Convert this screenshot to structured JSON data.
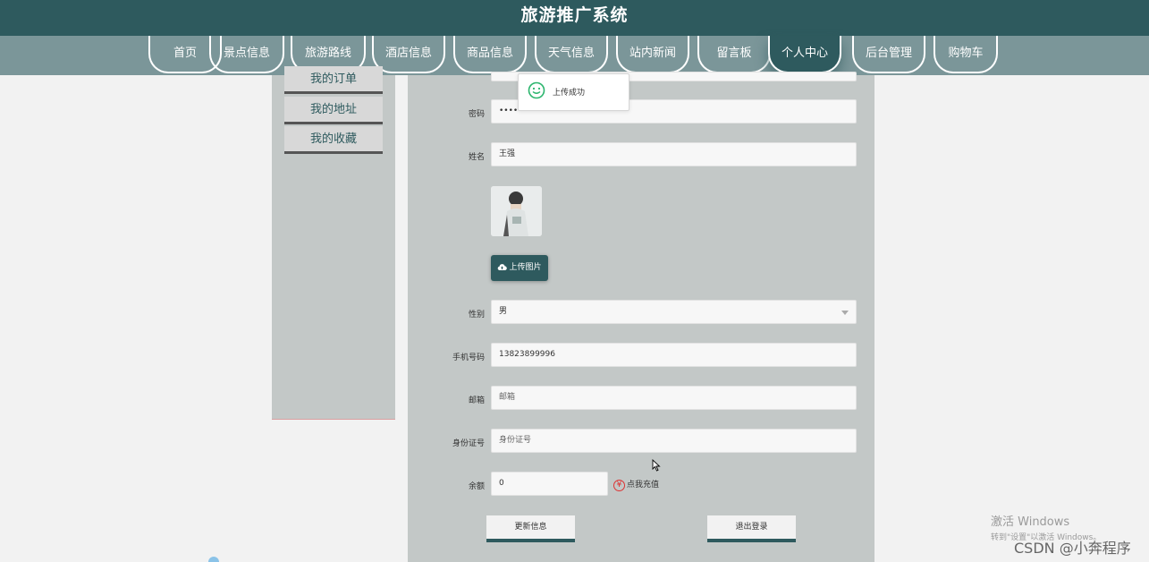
{
  "header": {
    "title": "旅游推广系统"
  },
  "nav": {
    "items": [
      {
        "label": "首页"
      },
      {
        "label": "景点信息"
      },
      {
        "label": "旅游路线"
      },
      {
        "label": "酒店信息"
      },
      {
        "label": "商品信息"
      },
      {
        "label": "天气信息"
      },
      {
        "label": "站内新闻"
      },
      {
        "label": "留言板"
      },
      {
        "label": "个人中心",
        "active": true
      },
      {
        "label": "后台管理"
      },
      {
        "label": "购物车"
      }
    ]
  },
  "sidebar": {
    "items": [
      {
        "label": "我的订单"
      },
      {
        "label": "我的地址"
      },
      {
        "label": "我的收藏"
      }
    ]
  },
  "form": {
    "password": {
      "label": "密码",
      "value": "••••••"
    },
    "name": {
      "label": "姓名",
      "value": "王强"
    },
    "upload_label": "上传图片",
    "gender": {
      "label": "性别",
      "value": "男"
    },
    "phone": {
      "label": "手机号码",
      "value": "13823899996"
    },
    "email": {
      "label": "邮箱",
      "placeholder": "邮箱"
    },
    "id_card": {
      "label": "身份证号",
      "placeholder": "身份证号"
    },
    "balance": {
      "label": "余额",
      "value": "0"
    },
    "recharge_label": "点我充值",
    "recharge_icon": "¥",
    "update_button": "更新信息",
    "logout_button": "退出登录"
  },
  "toast": {
    "message": "上传成功"
  },
  "watermark": {
    "line1": "激活 Windows",
    "line2": "转到\"设置\"以激活 Windows。"
  },
  "credit": "CSDN @小奔程序",
  "colors": {
    "primary": "#2e5a5e",
    "nav_bg": "#7b9699",
    "panel_bg": "#c3c8c7"
  }
}
